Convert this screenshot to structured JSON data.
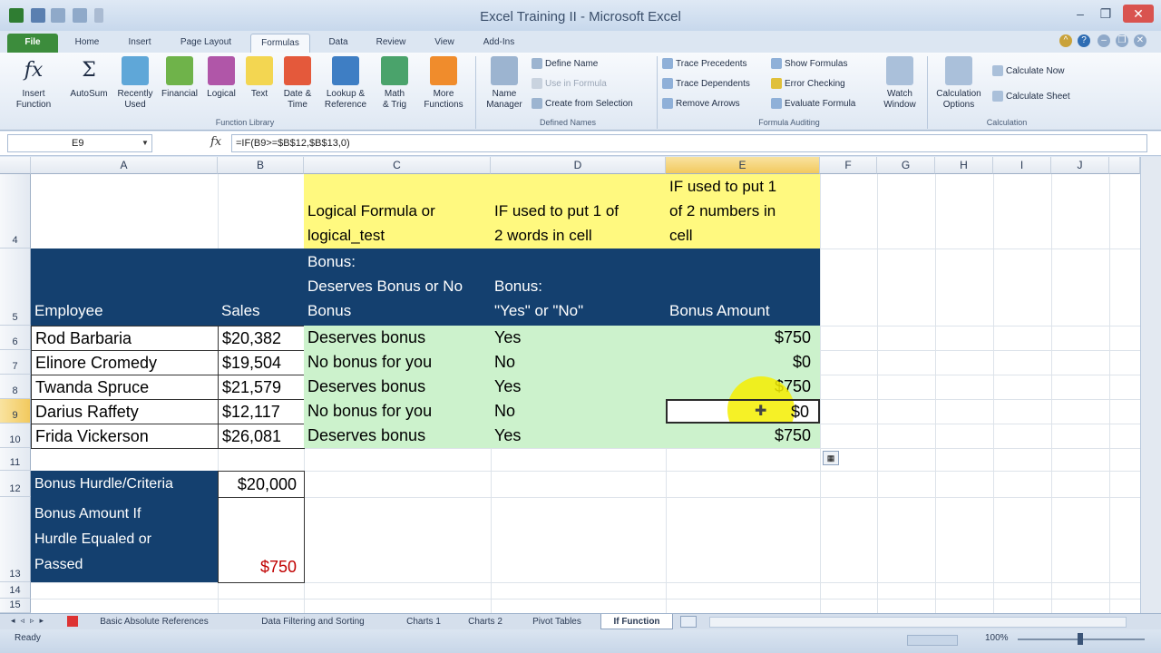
{
  "window": {
    "title": "Excel Training II - Microsoft Excel"
  },
  "ribbon_tabs": [
    "File",
    "Home",
    "Insert",
    "Page Layout",
    "Formulas",
    "Data",
    "Review",
    "View",
    "Add-Ins"
  ],
  "active_tab": "Formulas",
  "function_library": {
    "buttons": [
      {
        "label": "Insert\nFunction",
        "icon": "fx-icon"
      },
      {
        "label": "AutoSum",
        "icon": "sigma-icon"
      },
      {
        "label": "Recently\nUsed",
        "icon": "book-icon"
      },
      {
        "label": "Financial",
        "icon": "book-icon"
      },
      {
        "label": "Logical",
        "icon": "book-icon"
      },
      {
        "label": "Text",
        "icon": "book-icon"
      },
      {
        "label": "Date &\nTime",
        "icon": "book-icon"
      },
      {
        "label": "Lookup &\nReference",
        "icon": "book-icon"
      },
      {
        "label": "Math\n& Trig",
        "icon": "book-icon"
      },
      {
        "label": "More\nFunctions",
        "icon": "book-icon"
      }
    ],
    "group_label": "Function Library"
  },
  "defined_names": {
    "name_manager": "Name\nManager",
    "define_name": "Define Name",
    "use_in_formula": "Use in Formula",
    "create_from_selection": "Create from Selection",
    "group_label": "Defined Names"
  },
  "formula_auditing": {
    "trace_precedents": "Trace Precedents",
    "trace_dependents": "Trace Dependents",
    "remove_arrows": "Remove Arrows",
    "show_formulas": "Show Formulas",
    "error_checking": "Error Checking",
    "evaluate_formula": "Evaluate Formula",
    "watch_window": "Watch\nWindow",
    "group_label": "Formula Auditing"
  },
  "calculation": {
    "calc_options": "Calculation\nOptions",
    "calc_now": "Calculate Now",
    "calc_sheet": "Calculate Sheet",
    "group_label": "Calculation"
  },
  "formula_bar": {
    "name_box": "E9",
    "formula": "=IF(B9>=$B$12,$B$13,0)"
  },
  "columns": [
    "A",
    "B",
    "C",
    "D",
    "E",
    "F",
    "G",
    "H",
    "I",
    "J"
  ],
  "rows": [
    "4",
    "5",
    "6",
    "7",
    "8",
    "9",
    "10",
    "11",
    "12",
    "13",
    "14",
    "15"
  ],
  "sheet": {
    "header_yellow": {
      "c": "Logical Formula or\nlogical_test",
      "d": "IF used to put 1 of\n2 words in cell",
      "e": "IF used to put 1\nof 2 numbers in\ncell"
    },
    "header_navy": {
      "a": "Employee",
      "b": "Sales",
      "c": "Bonus:\nDeserves Bonus or No\nBonus",
      "d": "Bonus:\n\"Yes\" or \"No\"",
      "e": "Bonus Amount"
    },
    "data": [
      {
        "employee": "Rod Barbaria",
        "sales": "$20,382",
        "logical": "Deserves bonus",
        "yesno": "Yes",
        "amount": "$750"
      },
      {
        "employee": "Elinore Cromedy",
        "sales": "$19,504",
        "logical": "No bonus for you",
        "yesno": "No",
        "amount": "$0"
      },
      {
        "employee": "Twanda Spruce",
        "sales": "$21,579",
        "logical": "Deserves bonus",
        "yesno": "Yes",
        "amount": "$750"
      },
      {
        "employee": "Darius Raffety",
        "sales": "$12,117",
        "logical": "No bonus for you",
        "yesno": "No",
        "amount": "$0"
      },
      {
        "employee": "Frida Vickerson",
        "sales": "$26,081",
        "logical": "Deserves bonus",
        "yesno": "Yes",
        "amount": "$750"
      }
    ],
    "criteria_label": "Bonus Hurdle/Criteria",
    "criteria_value": "$20,000",
    "bonus_label": "Bonus Amount If\nHurdle Equaled or\nPassed",
    "bonus_value": "$750"
  },
  "sheet_tabs": [
    "Basic Absolute References",
    "Data Filtering and Sorting",
    "Charts 1",
    "Charts 2",
    "Pivot Tables",
    "If Function"
  ],
  "active_sheet": "If Function",
  "status": {
    "ready": "Ready",
    "zoom": "100%"
  }
}
